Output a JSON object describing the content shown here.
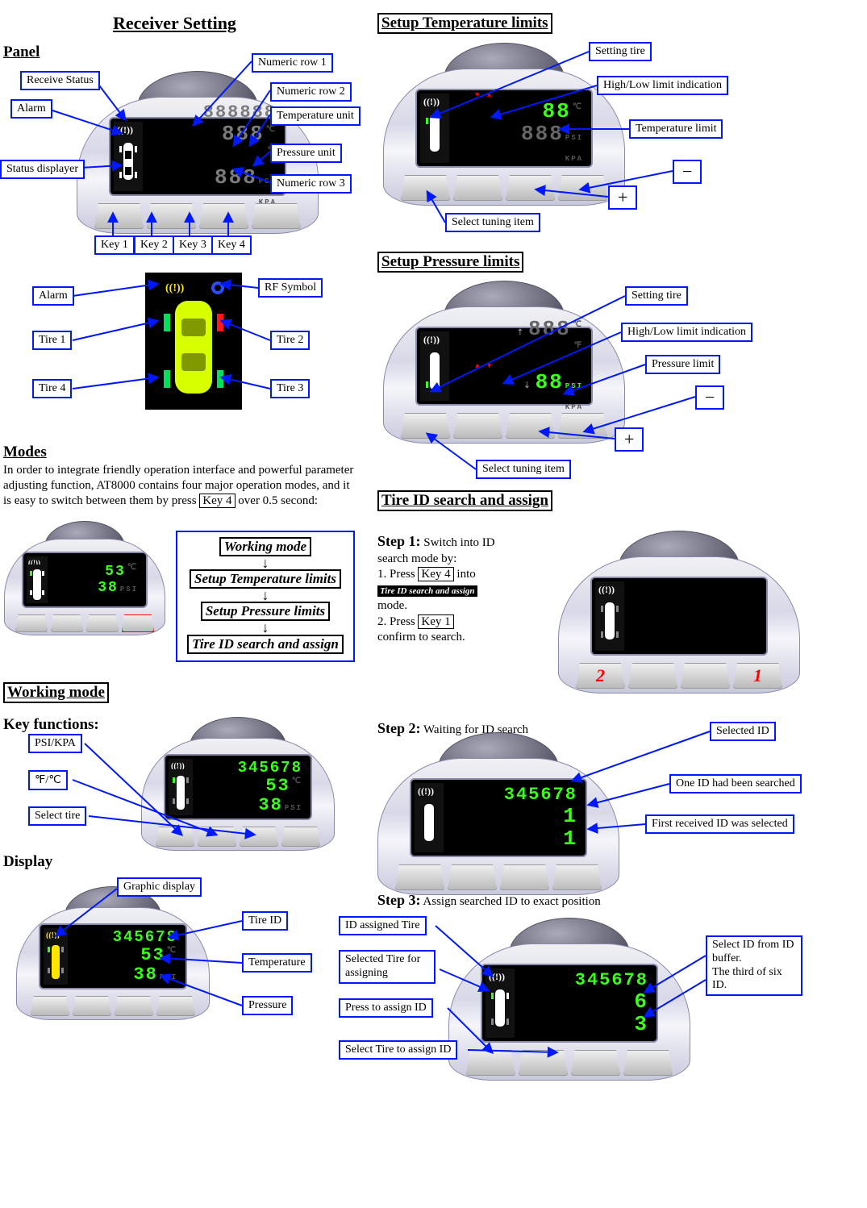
{
  "left": {
    "title": "Receiver Setting",
    "panel_heading": "Panel",
    "panel_callouts": {
      "receive_status": "Receive Status",
      "alarm": "Alarm",
      "status_displayer": "Status displayer",
      "numeric_row_1": "Numeric row 1",
      "numeric_row_2": "Numeric row 2",
      "temperature_unit": "Temperature unit",
      "pressure_unit": "Pressure unit",
      "numeric_row_3": "Numeric row 3",
      "key1": "Key 1",
      "key2": "Key 2",
      "key3": "Key 3",
      "key4": "Key 4"
    },
    "car_callouts": {
      "alarm": "Alarm",
      "tire1": "Tire 1",
      "tire4": "Tire 4",
      "rf_symbol": "RF Symbol",
      "tire2": "Tire 2",
      "tire3": "Tire 3"
    },
    "modes_heading": "Modes",
    "modes_para_a": "In order to integrate friendly operation interface and powerful parameter adjusting function, AT8000 contains four major operation modes, and it is easy to switch between them by press ",
    "modes_para_key": "Key 4",
    "modes_para_b": " over 0.5 second:",
    "modes_flow": {
      "m1": "Working mode",
      "m2": "Setup Temperature limits",
      "m3": "Setup Pressure limits",
      "m4": "Tire ID search and assign"
    },
    "modes_device": {
      "row2": "53",
      "row3": "38",
      "unit2": "℃",
      "unit3": "PSI"
    },
    "working_mode_heading": "Working mode",
    "keyfunc_heading": "Key functions:",
    "keyfunc_callouts": {
      "psi_kpa": "PSI/KPA",
      "fc": "℉/℃",
      "select_tire": "Select tire"
    },
    "working_device": {
      "row1": "345678",
      "row2": "53",
      "row3": "38",
      "unit2": "℃",
      "unit3": "PSI"
    },
    "display_heading": "Display",
    "display_callouts": {
      "graphic": "Graphic display",
      "tire_id": "Tire ID",
      "temperature": "Temperature",
      "pressure": "Pressure"
    },
    "display_device": {
      "row1": "345678",
      "row2": "53",
      "row3": "38",
      "unit2": "℃",
      "unit3": "PSI"
    }
  },
  "right": {
    "setup_temp_heading": "Setup Temperature limits",
    "setup_temp_callouts": {
      "setting_tire": "Setting tire",
      "hi_lo": "High/Low limit indication",
      "temp_limit": "Temperature limit",
      "minus": "−",
      "plus": "+",
      "select_tuning": "Select tuning item"
    },
    "setup_temp_device": {
      "row2": "88",
      "row3": "888",
      "unit2": "℃",
      "unit3a": "PSI",
      "unit3b": "KPA",
      "tri_up": "▲",
      "tri_dn": "▼"
    },
    "setup_press_heading": "Setup Pressure limits",
    "setup_press_callouts": {
      "setting_tire": "Setting tire",
      "hi_lo": "High/Low limit indication",
      "press_limit": "Pressure limit",
      "minus": "−",
      "plus": "+",
      "select_tuning": "Select tuning item"
    },
    "setup_press_device": {
      "row2": "888",
      "row3": "88",
      "unit2a": "℃",
      "unit2b": "℉",
      "unit3a": "PSI",
      "unit3b": "KPA",
      "tri_up": "▲",
      "tri_dn": "▼"
    },
    "tireid_heading": "Tire ID search and assign",
    "step1": {
      "title": "Step 1:",
      "a": " Switch into ID search mode by:",
      "l1a": "1. Press ",
      "l1key": "Key 4",
      "l1b": " into",
      "mode_box": "Tire ID search and assign",
      "l2": "mode.",
      "l3a": "2. Press ",
      "l3key": "Key 1",
      "l3b": " confirm to search.",
      "kn2": "2",
      "kn1": "1"
    },
    "step2": {
      "title": "Step 2:",
      "tail": " Waiting for ID search",
      "callouts": {
        "selected_id": "Selected ID",
        "one_id": "One ID had been searched",
        "first_recv": "First received ID was selected"
      },
      "device": {
        "row1": "345678",
        "row2": "1",
        "row3": "1"
      }
    },
    "step3": {
      "title": "Step 3:",
      "tail": " Assign searched ID to exact position",
      "callouts": {
        "assigned_tire": "ID assigned Tire",
        "selected_tire": "Selected Tire for assigning",
        "press_assign": "Press to assign ID",
        "select_tire_assign": "Select Tire to assign ID",
        "select_id_buf": "Select ID from ID buffer.\nThe third of six ID."
      },
      "device": {
        "row1": "345678",
        "row2": "6",
        "row3": "3"
      }
    }
  }
}
